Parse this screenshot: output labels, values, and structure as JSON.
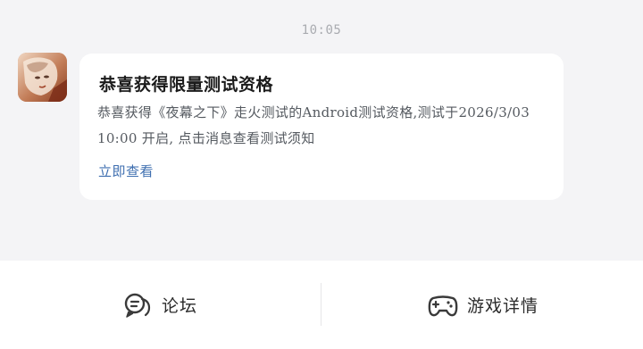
{
  "chat": {
    "timestamp": "10:05",
    "message": {
      "title": "恭喜获得限量测试资格",
      "body": "恭喜获得《夜幕之下》走火测试的Android测试资格,测试于2026/3/03 10:00 开启, 点击消息查看测试须知",
      "link_label": "立即查看"
    }
  },
  "bottom_bar": {
    "forum_label": "论坛",
    "game_details_label": "游戏详情"
  },
  "colors": {
    "background": "#f4f4f6",
    "bubble": "#ffffff",
    "link": "#3f6fb0",
    "title": "#1b1b1b",
    "body_text": "#555a60"
  }
}
